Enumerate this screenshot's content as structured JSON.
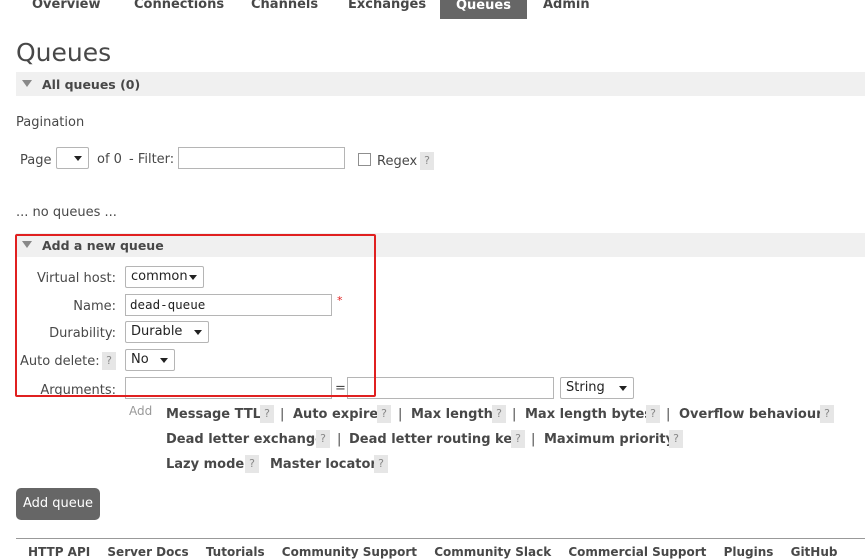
{
  "nav": {
    "tabs": [
      "Overview",
      "Connections",
      "Channels",
      "Exchanges",
      "Queues",
      "Admin"
    ],
    "active": "Queues"
  },
  "page_title": "Queues",
  "all_queues": {
    "title": "All queues (0)"
  },
  "pagination": {
    "label": "Pagination",
    "page_label": "Page",
    "page_value": "",
    "of_label": "of 0",
    "filter_label": "- Filter:",
    "filter_value": "",
    "regex_label": "Regex",
    "help": "?"
  },
  "no_queues_text": "... no queues ...",
  "add_queue_section": {
    "title": "Add a new queue",
    "virtual_host_label": "Virtual host:",
    "virtual_host_value": "common",
    "name_label": "Name:",
    "name_value": "dead-queue",
    "required_mark": "*",
    "durability_label": "Durability:",
    "durability_value": "Durable",
    "auto_delete_label": "Auto delete:",
    "auto_delete_value": "No",
    "arguments_label": "Arguments:",
    "arg_key_value": "",
    "equals": "=",
    "arg_value_value": "",
    "arg_type_value": "String",
    "add_label": "Add",
    "help": "?"
  },
  "argument_shortcuts": {
    "row1": [
      "Message TTL",
      "Auto expire",
      "Max length",
      "Max length bytes",
      "Overflow behaviour"
    ],
    "row2": [
      "Dead letter exchange",
      "Dead letter routing key",
      "Maximum priority"
    ],
    "row3": [
      "Lazy mode",
      "Master locator"
    ],
    "separator": "|"
  },
  "add_queue_button": "Add queue",
  "footer": {
    "links": [
      "HTTP API",
      "Server Docs",
      "Tutorials",
      "Community Support",
      "Community Slack",
      "Commercial Support",
      "Plugins",
      "GitHub"
    ]
  },
  "colors": {
    "highlight": "#e02020",
    "nav_active_bg": "#666666",
    "section_bg": "#f0f0f0",
    "button_bg": "#666666"
  }
}
